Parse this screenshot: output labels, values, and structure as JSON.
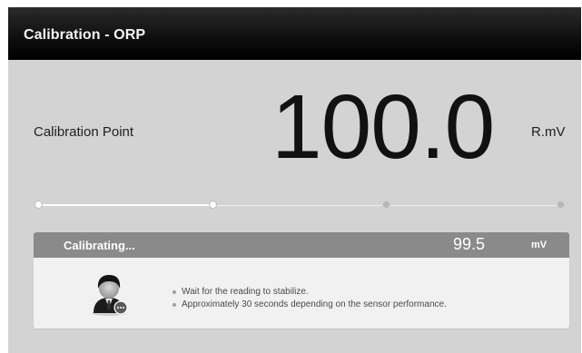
{
  "header": {
    "title": "Calibration - ORP"
  },
  "calibration": {
    "point_label": "Calibration Point",
    "value": "100.0",
    "unit": "R.mV"
  },
  "progress": {
    "steps_total": 4,
    "steps_done": 2
  },
  "status_panel": {
    "status": "Calibrating...",
    "reading": "99.5",
    "unit": "mV",
    "avatar_icon": "operator-avatar-icon",
    "messages": [
      "Wait for the reading to stabilize.",
      "Approximately 30 seconds depending on the sensor performance."
    ]
  },
  "colors": {
    "header": "#000000",
    "background": "#d3d3d3",
    "panel_bar": "#8a8a8a",
    "panel_body": "#f1f1f1"
  }
}
